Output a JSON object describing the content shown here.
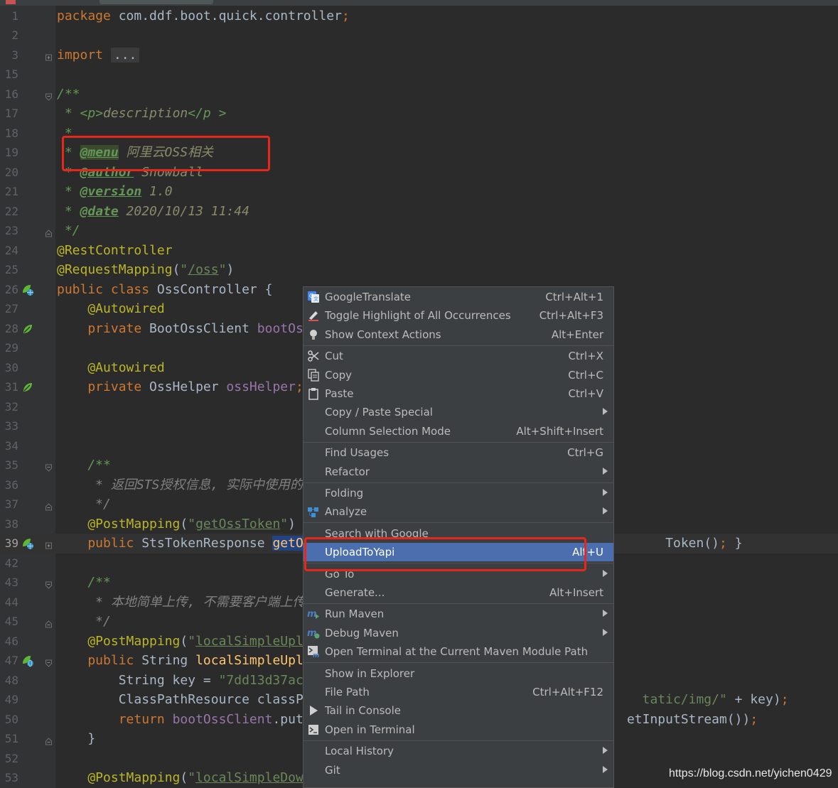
{
  "colors": {
    "editor_bg": "#2b2b2b",
    "gutter_bg": "#313335",
    "menu_bg": "#3c3f41",
    "menu_active": "#4b6eaf",
    "highlight_box": "#e8261c"
  },
  "editor": {
    "lines": [
      {
        "num": "1",
        "segs": [
          [
            "kw",
            "package "
          ],
          [
            "",
            "com.ddf.boot.quick.controller"
          ],
          [
            "kw",
            ";"
          ]
        ]
      },
      {
        "num": "2",
        "segs": []
      },
      {
        "num": "3",
        "segs": [
          [
            "kw",
            "import "
          ],
          [
            "fold-box",
            "..."
          ]
        ],
        "fold": "plus"
      },
      {
        "num": "15",
        "segs": []
      },
      {
        "num": "16",
        "segs": [
          [
            "doc",
            "/**"
          ]
        ],
        "fold": "open"
      },
      {
        "num": "17",
        "segs": [
          [
            "doc",
            " * "
          ],
          [
            "doc",
            "<p>"
          ],
          [
            "docv",
            "description"
          ],
          [
            "doc",
            "</p >"
          ]
        ]
      },
      {
        "num": "18",
        "segs": [
          [
            "doc",
            " *"
          ]
        ]
      },
      {
        "num": "19",
        "segs": [
          [
            "doc",
            " * "
          ],
          [
            "tag tagbg",
            "@menu"
          ],
          [
            "docv",
            " 阿里云OSS相关"
          ]
        ]
      },
      {
        "num": "20",
        "segs": [
          [
            "doc",
            " * "
          ],
          [
            "tag",
            "@author"
          ],
          [
            "docv",
            " Snowball"
          ]
        ]
      },
      {
        "num": "21",
        "segs": [
          [
            "doc",
            " * "
          ],
          [
            "tag",
            "@version"
          ],
          [
            "docv",
            " 1.0"
          ]
        ]
      },
      {
        "num": "22",
        "segs": [
          [
            "doc",
            " * "
          ],
          [
            "tag",
            "@date"
          ],
          [
            "docv",
            " 2020/10/13 11:44"
          ]
        ]
      },
      {
        "num": "23",
        "segs": [
          [
            "doc",
            " */"
          ]
        ],
        "fold": "close"
      },
      {
        "num": "24",
        "segs": [
          [
            "ann",
            "@RestController"
          ]
        ]
      },
      {
        "num": "25",
        "segs": [
          [
            "ann",
            "@RequestMapping"
          ],
          [
            "",
            "("
          ],
          [
            "str",
            "\""
          ],
          [
            "strl",
            "/oss"
          ],
          [
            "str",
            "\""
          ],
          [
            "",
            ")"
          ]
        ]
      },
      {
        "num": "26",
        "segs": [
          [
            "kw",
            "public class "
          ],
          [
            "",
            "OssController {"
          ]
        ],
        "icon": "bean-globe"
      },
      {
        "num": "27",
        "segs": [
          [
            "ann",
            "    @Autowired"
          ]
        ]
      },
      {
        "num": "28",
        "segs": [
          [
            "kw",
            "    private "
          ],
          [
            "",
            "BootOssClient "
          ],
          [
            "fld",
            "bootOs"
          ]
        ],
        "icon": "bean"
      },
      {
        "num": "29",
        "segs": []
      },
      {
        "num": "30",
        "segs": [
          [
            "ann",
            "    @Autowired"
          ]
        ]
      },
      {
        "num": "31",
        "segs": [
          [
            "kw",
            "    private "
          ],
          [
            "",
            "OssHelper "
          ],
          [
            "fld",
            "ossHelper"
          ],
          [
            "kw",
            ";"
          ]
        ],
        "icon": "bean"
      },
      {
        "num": "32",
        "segs": []
      },
      {
        "num": "33",
        "segs": []
      },
      {
        "num": "34",
        "segs": []
      },
      {
        "num": "35",
        "segs": [
          [
            "doc",
            "    /**"
          ]
        ],
        "fold": "open"
      },
      {
        "num": "36",
        "segs": [
          [
            "grey",
            "     * 返回STS授权信息, 实际中使用的"
          ]
        ]
      },
      {
        "num": "37",
        "segs": [
          [
            "grey",
            "     */"
          ]
        ],
        "fold": "close"
      },
      {
        "num": "38",
        "segs": [
          [
            "ann",
            "    @PostMapping"
          ],
          [
            "",
            "("
          ],
          [
            "str",
            "\""
          ],
          [
            "strl",
            "getOssToken"
          ],
          [
            "str",
            "\""
          ],
          [
            "",
            ")"
          ]
        ]
      },
      {
        "num": "39",
        "segs": [
          [
            "kw",
            "    public "
          ],
          [
            "",
            "StsTokenResponse "
          ],
          [
            "selhl fn",
            "getO"
          ],
          [
            "",
            "                                               Token()"
          ],
          [
            "kw",
            ";"
          ],
          [
            "",
            " }"
          ]
        ],
        "icon": "bean-globe",
        "fold": "plus",
        "current": true
      },
      {
        "num": "42",
        "segs": []
      },
      {
        "num": "43",
        "segs": [
          [
            "doc",
            "    /**"
          ]
        ],
        "fold": "open"
      },
      {
        "num": "44",
        "segs": [
          [
            "grey",
            "     * 本地简单上传, 不需要客户端上传"
          ]
        ]
      },
      {
        "num": "45",
        "segs": [
          [
            "grey",
            "     */"
          ]
        ],
        "fold": "close"
      },
      {
        "num": "46",
        "segs": [
          [
            "ann",
            "    @PostMapping"
          ],
          [
            "",
            "("
          ],
          [
            "str",
            "\""
          ],
          [
            "strl",
            "localSimpleUpl"
          ]
        ]
      },
      {
        "num": "47",
        "segs": [
          [
            "kw",
            "    public "
          ],
          [
            "",
            "String "
          ],
          [
            "fn",
            "localSimpleUpl"
          ]
        ],
        "icon": "globe",
        "fold": "open"
      },
      {
        "num": "48",
        "segs": [
          [
            "",
            "        String key = "
          ],
          [
            "str",
            "\"7dd13d37ac"
          ]
        ]
      },
      {
        "num": "49",
        "segs": [
          [
            "",
            "        ClassPathResource classP"
          ],
          [
            "",
            "                                            "
          ],
          [
            "str",
            "tatic/img/\""
          ],
          [
            "",
            " + key)"
          ],
          [
            "kw",
            ";"
          ]
        ]
      },
      {
        "num": "50",
        "segs": [
          [
            "kw",
            "        return "
          ],
          [
            "fld",
            "bootOssClient"
          ],
          [
            "",
            ".put"
          ],
          [
            "",
            "                                          etInputStream())"
          ],
          [
            "kw",
            ";"
          ]
        ]
      },
      {
        "num": "51",
        "segs": [
          [
            "",
            "    }"
          ]
        ],
        "fold": "close"
      },
      {
        "num": "52",
        "segs": []
      },
      {
        "num": "53",
        "segs": [
          [
            "ann",
            "    @PostMapping"
          ],
          [
            "",
            "("
          ],
          [
            "str",
            "\""
          ],
          [
            "strl",
            "localSimpleDow"
          ]
        ]
      }
    ]
  },
  "context_menu": {
    "groups": [
      [
        {
          "label": "GoogleTranslate",
          "shortcut": "Ctrl+Alt+1",
          "icon": "google-translate-icon"
        },
        {
          "label": "Toggle Highlight of All Occurrences",
          "shortcut": "Ctrl+Alt+F3",
          "icon": "highlighter-icon"
        },
        {
          "label": "Show Context Actions",
          "shortcut": "Alt+Enter",
          "icon": "lightbulb-icon"
        }
      ],
      [
        {
          "label": "Cut",
          "shortcut": "Ctrl+X",
          "icon": "scissors-icon"
        },
        {
          "label": "Copy",
          "shortcut": "Ctrl+C",
          "icon": "copy-icon"
        },
        {
          "label": "Paste",
          "shortcut": "Ctrl+V",
          "icon": "clipboard-icon"
        },
        {
          "label": "Copy / Paste Special",
          "submenu": true
        },
        {
          "label": "Column Selection Mode",
          "shortcut": "Alt+Shift+Insert"
        }
      ],
      [
        {
          "label": "Find Usages",
          "shortcut": "Ctrl+G"
        },
        {
          "label": "Refactor",
          "submenu": true
        }
      ],
      [
        {
          "label": "Folding",
          "submenu": true
        },
        {
          "label": "Analyze",
          "submenu": true,
          "icon": "analyze-icon"
        }
      ],
      [
        {
          "label": "Search with Google"
        },
        {
          "label": "UploadToYapi",
          "shortcut": "Alt+U",
          "active": true
        }
      ],
      [
        {
          "label": "Go To",
          "submenu": true
        },
        {
          "label": "Generate...",
          "shortcut": "Alt+Insert"
        }
      ],
      [
        {
          "label": "Run Maven",
          "submenu": true,
          "icon": "maven-run-icon"
        },
        {
          "label": "Debug Maven",
          "submenu": true,
          "icon": "maven-debug-icon"
        },
        {
          "label": "Open Terminal at the Current Maven Module Path",
          "icon": "maven-terminal-icon"
        }
      ],
      [
        {
          "label": "Show in Explorer"
        },
        {
          "label": "File Path",
          "shortcut": "Ctrl+Alt+F12"
        },
        {
          "label": "Tail in Console",
          "icon": "play-icon"
        },
        {
          "label": "Open in Terminal",
          "icon": "terminal-icon"
        }
      ],
      [
        {
          "label": "Local History",
          "submenu": true
        },
        {
          "label": "Git",
          "submenu": true
        }
      ]
    ]
  },
  "watermark": "https://blog.csdn.net/yichen0429"
}
